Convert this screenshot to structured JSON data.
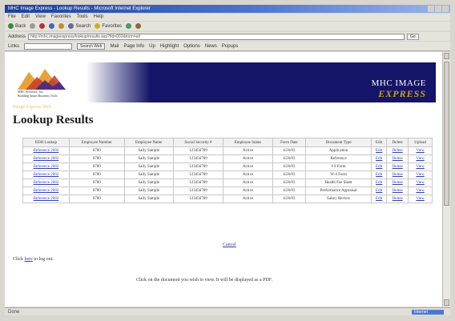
{
  "browser": {
    "title": "MHC Image Express - Lookup Results - Microsoft Internet Explorer",
    "menu": [
      "File",
      "Edit",
      "View",
      "Favorites",
      "Tools",
      "Help"
    ],
    "toolbar": [
      "Back",
      "Forward",
      "Stop",
      "Refresh",
      "Home",
      "Search",
      "Favorites",
      "History",
      "Mail"
    ],
    "address_label": "Address",
    "address_value": "http://mhc.imageexpress/lookup/results.asp?fid=002&form=all",
    "go_label": "Go",
    "links_label": "Links",
    "search_button": "Search Web",
    "links": [
      "Mail",
      "Page Info",
      "Up",
      "Highlight",
      "Options",
      "News",
      "Popups"
    ],
    "status_text": "Done",
    "status_zone": "Internet"
  },
  "banner": {
    "company": "MHC Software, Inc.",
    "tagline": "Building Smart Business Tools",
    "brand_line1": "MHC IMAGE",
    "brand_line2": "EXPRESS",
    "subtitle": "Image Express Web"
  },
  "page_title": "Lookup Results",
  "table": {
    "headers": [
      "EDH Lookup",
      "Employee Number",
      "Employee Name",
      "Social Security #",
      "Employee Status",
      "Form Date",
      "Document Type",
      "Edit",
      "Delete",
      "Upload"
    ],
    "rows": [
      {
        "ref": "Reference 2002",
        "number": "0789",
        "name": "Sally Sample",
        "ssn": "123456789",
        "status": "Active",
        "date": "4/26/03",
        "doc": "Application",
        "edit": "Edit",
        "delete": "Delete",
        "upload": "View"
      },
      {
        "ref": "Reference 2002",
        "number": "0789",
        "name": "Sally Sample",
        "ssn": "123456789",
        "status": "Active",
        "date": "4/26/03",
        "doc": "Reference",
        "edit": "Edit",
        "delete": "Delete",
        "upload": "View"
      },
      {
        "ref": "Reference 2002",
        "number": "0789",
        "name": "Sally Sample",
        "ssn": "123456789",
        "status": "Active",
        "date": "4/26/03",
        "doc": "I-9 Form",
        "edit": "Edit",
        "delete": "Delete",
        "upload": "View"
      },
      {
        "ref": "Reference 2002",
        "number": "0789",
        "name": "Sally Sample",
        "ssn": "123456789",
        "status": "Active",
        "date": "4/26/03",
        "doc": "W-4 Form",
        "edit": "Edit",
        "delete": "Delete",
        "upload": "View"
      },
      {
        "ref": "Reference 2002",
        "number": "0789",
        "name": "Sally Sample",
        "ssn": "123456789",
        "status": "Active",
        "date": "4/26/03",
        "doc": "Health Fee Sheet",
        "edit": "Edit",
        "delete": "Delete",
        "upload": "View"
      },
      {
        "ref": "Reference 2002",
        "number": "0789",
        "name": "Sally Sample",
        "ssn": "123456789",
        "status": "Active",
        "date": "4/26/03",
        "doc": "Performance Appraisal",
        "edit": "Edit",
        "delete": "Delete",
        "upload": "View"
      },
      {
        "ref": "Reference 2002",
        "number": "0789",
        "name": "Sally Sample",
        "ssn": "123456789",
        "status": "Active",
        "date": "4/26/03",
        "doc": "Salary Review",
        "edit": "Edit",
        "delete": "Delete",
        "upload": "View"
      }
    ]
  },
  "cancel_link": "Cancel",
  "logout": {
    "prefix": "Click",
    "link": "here",
    "suffix": "to log out."
  },
  "note": "Click on the document you wish to view. It will be displayed as a PDF.",
  "colors": {
    "banner": "#141468",
    "brand_gold": "#c9a31f",
    "link": "#2f3fb0"
  }
}
